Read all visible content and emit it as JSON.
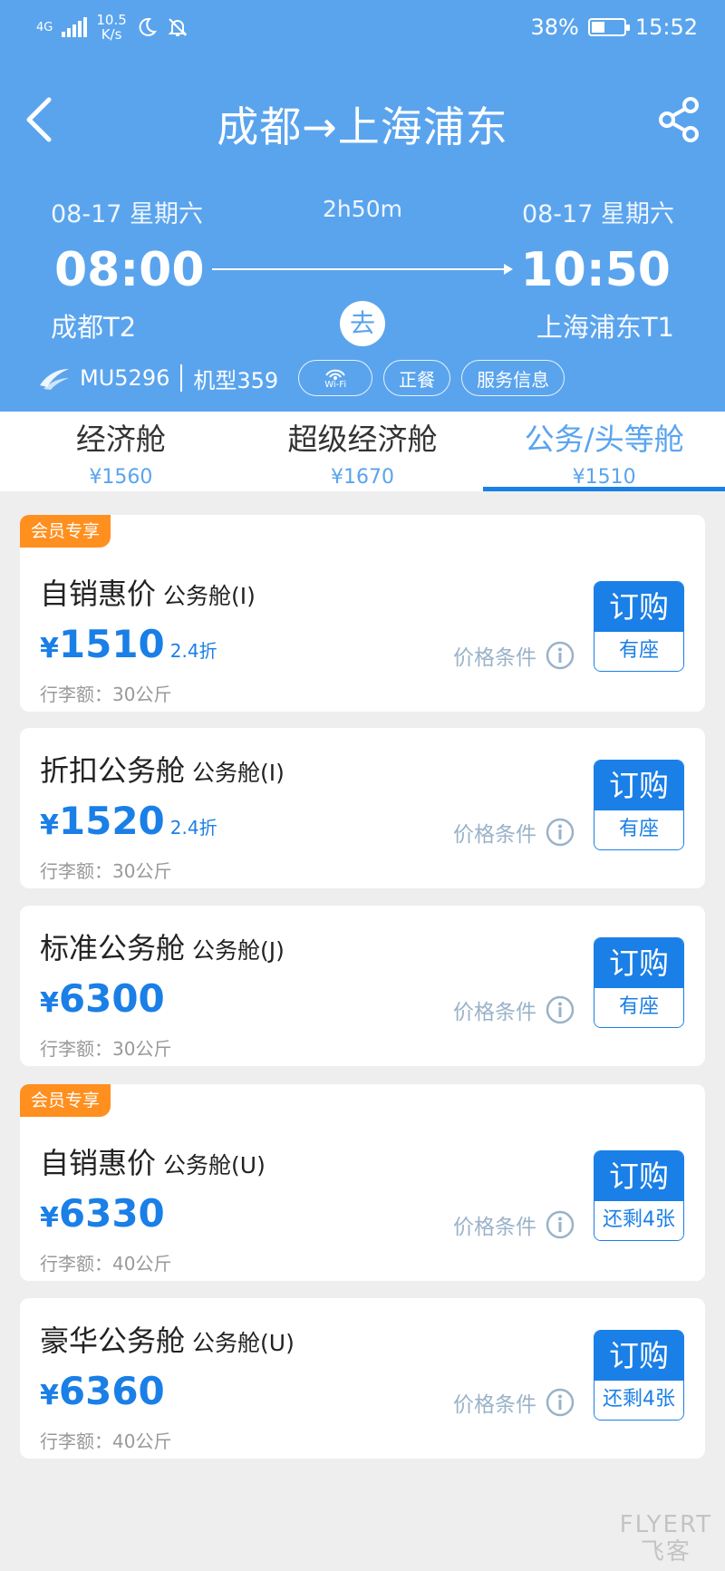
{
  "status_bar": {
    "network": "4G",
    "speed_value": "10.5",
    "speed_unit": "K/s",
    "battery": "38%",
    "battery_level": 0.38,
    "time": "15:52"
  },
  "nav": {
    "title": "成都→上海浦东"
  },
  "flight": {
    "dep_date": "08-17 星期六",
    "arr_date": "08-17 星期六",
    "duration": "2h50m",
    "dep_time": "08:00",
    "arr_time": "10:50",
    "dep_airport": "成都T2",
    "arr_airport": "上海浦东T1",
    "direction": "去",
    "flight_no": "MU5296",
    "aircraft": "机型359",
    "wifi_label": "Wi-Fi",
    "meal": "正餐",
    "service": "服务信息"
  },
  "tabs": [
    {
      "name": "经济舱",
      "price": "¥1560"
    },
    {
      "name": "超级经济舱",
      "price": "¥1670"
    },
    {
      "name": "公务/头等舱",
      "price": "¥1510"
    }
  ],
  "fares": [
    {
      "badge": "会员专享",
      "name": "自销惠价",
      "cabin": "公务舱(I)",
      "price": "1510",
      "discount": "2.4折",
      "baggage": "行李额：30公斤",
      "condition": "价格条件",
      "book": "订购",
      "seats": "有座"
    },
    {
      "badge": "",
      "name": "折扣公务舱",
      "cabin": "公务舱(I)",
      "price": "1520",
      "discount": "2.4折",
      "baggage": "行李额：30公斤",
      "condition": "价格条件",
      "book": "订购",
      "seats": "有座"
    },
    {
      "badge": "",
      "name": "标准公务舱",
      "cabin": "公务舱(J)",
      "price": "6300",
      "discount": "",
      "baggage": "行李额：30公斤",
      "condition": "价格条件",
      "book": "订购",
      "seats": "有座"
    },
    {
      "badge": "会员专享",
      "name": "自销惠价",
      "cabin": "公务舱(U)",
      "price": "6330",
      "discount": "",
      "baggage": "行李额：40公斤",
      "condition": "价格条件",
      "book": "订购",
      "seats": "还剩4张"
    },
    {
      "badge": "",
      "name": "豪华公务舱",
      "cabin": "公务舱(U)",
      "price": "6360",
      "discount": "",
      "baggage": "行李额：40公斤",
      "condition": "价格条件",
      "book": "订购",
      "seats": "还剩4张"
    }
  ],
  "currency": "¥",
  "watermark": {
    "line1": "FLYERT",
    "line2": "飞客"
  },
  "colors": {
    "header": "#5aa4ee",
    "accent": "#1a7fe6",
    "member_badge": "#ff8f1f"
  }
}
